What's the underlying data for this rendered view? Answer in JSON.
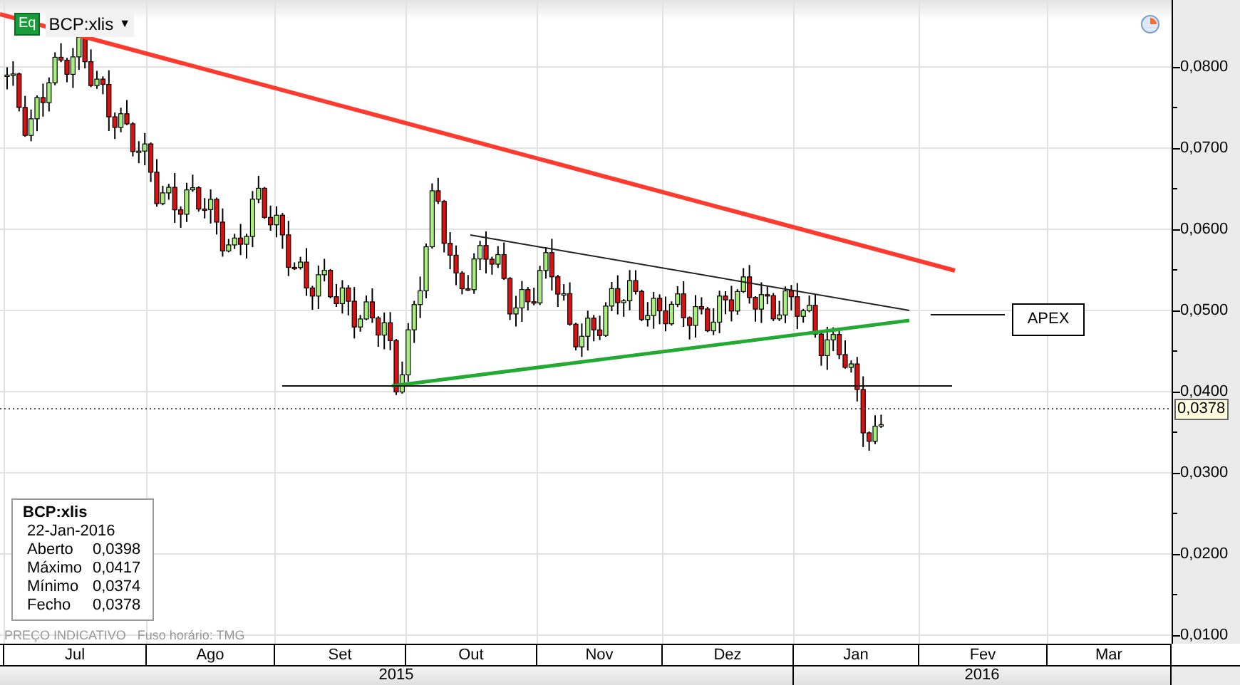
{
  "header": {
    "badge": "Eq",
    "symbol": "BCP:xlis",
    "caret": "▼"
  },
  "annotation": {
    "label": "APEX"
  },
  "info_box": {
    "title": "BCP:xlis",
    "date": "22-Jan-2016",
    "rows": [
      {
        "label": "Aberto",
        "value": "0,0398"
      },
      {
        "label": "Máximo",
        "value": "0,0417"
      },
      {
        "label": "Mínimo",
        "value": "0,0374"
      },
      {
        "label": "Fecho",
        "value": "0,0378"
      }
    ]
  },
  "footer": {
    "note": "PREÇO INDICATIVO",
    "timezone": "Fuso horário: TMG"
  },
  "y_axis": {
    "ticks": [
      "0,0800",
      "0,0700",
      "0,0600",
      "0,0500",
      "0,0400",
      "0,0300",
      "0,0200",
      "0,0100"
    ],
    "last_price": "0,0378"
  },
  "x_axis": {
    "months": [
      "Jul",
      "Ago",
      "Set",
      "Out",
      "Nov",
      "Dez",
      "Jan",
      "Fev",
      "Mar"
    ],
    "years": [
      "2015",
      "2016"
    ]
  }
}
